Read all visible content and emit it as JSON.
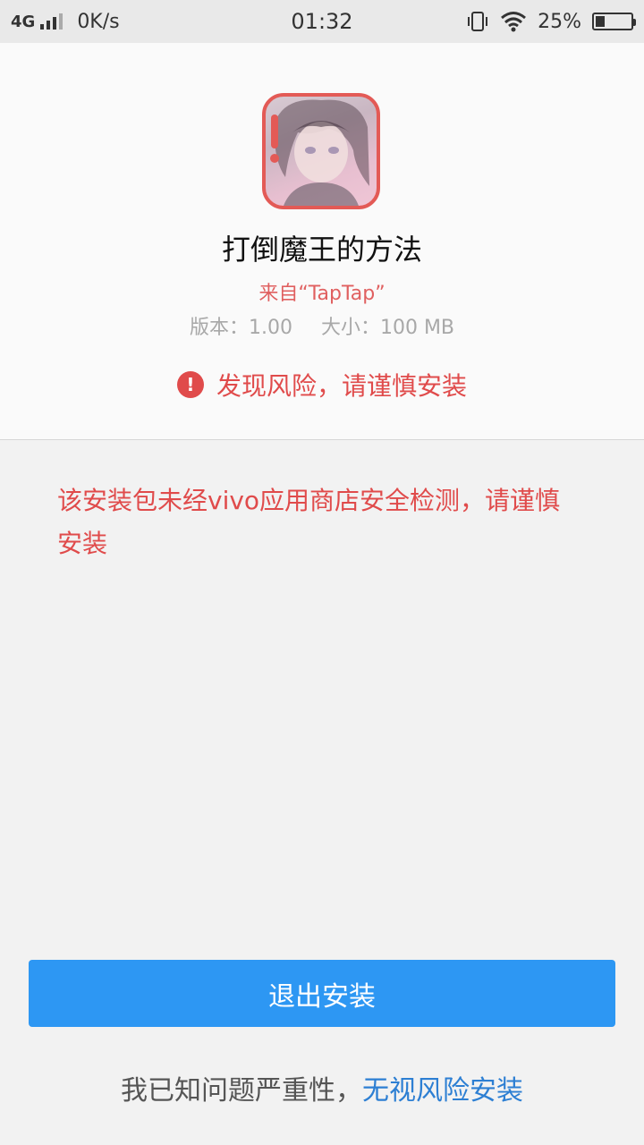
{
  "status_bar": {
    "network": "4G",
    "speed": "0K/s",
    "time": "01:32",
    "battery_pct": "25%",
    "battery_level": 0.25,
    "icons": [
      "signal-icon",
      "vibrate-icon",
      "wifi-icon",
      "battery-icon"
    ]
  },
  "app": {
    "name": "打倒魔王的方法",
    "source": "来自“TapTap”",
    "version": "版本：1.00",
    "size": "大小：100 MB",
    "icon": "app-icon"
  },
  "risk": {
    "label": "发现风险，请谨慎安装",
    "icon": "exclamation-icon"
  },
  "warning": {
    "text": "该安装包未经vivo应用商店安全检测，请谨慎安装"
  },
  "actions": {
    "exit_label": "退出安装",
    "aware_text": "我已知问题严重性，",
    "ignore_label": "无视风险安装"
  },
  "colors": {
    "danger": "#e04b4b",
    "primary": "#2d97f3",
    "link": "#2d7fd3"
  }
}
